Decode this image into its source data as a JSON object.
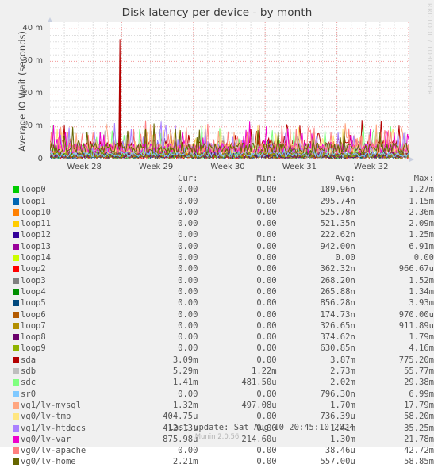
{
  "title": "Disk latency per device - by month",
  "watermark": "RRDTOOL / TOBI OETIKER",
  "footer": {
    "last_update": "Last update: Sat Aug 10 20:45:10 2024",
    "version": "Munin 2.0.56"
  },
  "legend_headers": {
    "cur": "Cur:",
    "min": "Min:",
    "avg": "Avg:",
    "max": "Max:"
  },
  "chart_data": {
    "type": "line",
    "title": "Disk latency per device - by month",
    "xlabel": "",
    "ylabel": "Average IO Wait (seconds)",
    "ylim": [
      0,
      0.042
    ],
    "ytick_labels": [
      "40 m",
      "30 m",
      "20 m",
      "10 m",
      "0"
    ],
    "ytick_values": [
      0.04,
      0.03,
      0.02,
      0.01,
      0
    ],
    "xtick_labels": [
      "Week 28",
      "Week 29",
      "Week 30",
      "Week 31",
      "Week 32"
    ],
    "grid": true,
    "legend_position": "below",
    "units": "seconds",
    "series": [
      {
        "name": "loop0",
        "color": "#00cc00",
        "cur": "0.00",
        "min": "0.00",
        "avg": "189.96n",
        "max": "1.27m"
      },
      {
        "name": "loop1",
        "color": "#0066b3",
        "cur": "0.00",
        "min": "0.00",
        "avg": "295.74n",
        "max": "1.15m"
      },
      {
        "name": "loop10",
        "color": "#ff8000",
        "cur": "0.00",
        "min": "0.00",
        "avg": "525.78n",
        "max": "2.36m"
      },
      {
        "name": "loop11",
        "color": "#ffcc00",
        "cur": "0.00",
        "min": "0.00",
        "avg": "521.35n",
        "max": "2.09m"
      },
      {
        "name": "loop12",
        "color": "#330099",
        "cur": "0.00",
        "min": "0.00",
        "avg": "222.62n",
        "max": "1.25m"
      },
      {
        "name": "loop13",
        "color": "#990099",
        "cur": "0.00",
        "min": "0.00",
        "avg": "942.00n",
        "max": "6.91m"
      },
      {
        "name": "loop14",
        "color": "#ccff00",
        "cur": "0.00",
        "min": "0.00",
        "avg": "0.00",
        "max": "0.00"
      },
      {
        "name": "loop2",
        "color": "#ff0000",
        "cur": "0.00",
        "min": "0.00",
        "avg": "362.32n",
        "max": "966.67u"
      },
      {
        "name": "loop3",
        "color": "#808080",
        "cur": "0.00",
        "min": "0.00",
        "avg": "268.20n",
        "max": "1.52m"
      },
      {
        "name": "loop4",
        "color": "#008f00",
        "cur": "0.00",
        "min": "0.00",
        "avg": "265.88n",
        "max": "1.34m"
      },
      {
        "name": "loop5",
        "color": "#00487d",
        "cur": "0.00",
        "min": "0.00",
        "avg": "856.28n",
        "max": "3.93m"
      },
      {
        "name": "loop6",
        "color": "#b35a00",
        "cur": "0.00",
        "min": "0.00",
        "avg": "174.73n",
        "max": "970.00u"
      },
      {
        "name": "loop7",
        "color": "#b38f00",
        "cur": "0.00",
        "min": "0.00",
        "avg": "326.65n",
        "max": "911.89u"
      },
      {
        "name": "loop8",
        "color": "#6b006b",
        "cur": "0.00",
        "min": "0.00",
        "avg": "374.62n",
        "max": "1.79m"
      },
      {
        "name": "loop9",
        "color": "#8fb300",
        "cur": "0.00",
        "min": "0.00",
        "avg": "630.85n",
        "max": "4.16m"
      },
      {
        "name": "sda",
        "color": "#b30000",
        "cur": "3.09m",
        "min": "0.00",
        "avg": "3.87m",
        "max": "775.20m"
      },
      {
        "name": "sdb",
        "color": "#bebebe",
        "cur": "5.29m",
        "min": "1.22m",
        "avg": "2.73m",
        "max": "55.77m"
      },
      {
        "name": "sdc",
        "color": "#80ff80",
        "cur": "1.41m",
        "min": "481.50u",
        "avg": "2.02m",
        "max": "29.38m"
      },
      {
        "name": "sr0",
        "color": "#80c9ff",
        "cur": "0.00",
        "min": "0.00",
        "avg": "796.30n",
        "max": "6.99m"
      },
      {
        "name": "vg1/lv-mysql",
        "color": "#ffa680",
        "cur": "1.32m",
        "min": "497.08u",
        "avg": "1.70m",
        "max": "17.79m"
      },
      {
        "name": "vg0/lv-tmp",
        "color": "#ffe680",
        "cur": "404.75u",
        "min": "0.00",
        "avg": "736.39u",
        "max": "58.20m"
      },
      {
        "name": "vg1/lv-htdocs",
        "color": "#aa80ff",
        "cur": "412.13u",
        "min": "0.00",
        "avg": "1.41m",
        "max": "35.25m"
      },
      {
        "name": "vg0/lv-var",
        "color": "#ee00cc",
        "cur": "875.98u",
        "min": "214.60u",
        "avg": "1.30m",
        "max": "21.78m"
      },
      {
        "name": "vg0/lv-apache",
        "color": "#ff8080",
        "cur": "0.00",
        "min": "0.00",
        "avg": "38.46u",
        "max": "42.72m"
      },
      {
        "name": "vg0/lv-home",
        "color": "#666600",
        "cur": "2.21m",
        "min": "0.00",
        "avg": "557.00u",
        "max": "58.85m"
      }
    ]
  }
}
